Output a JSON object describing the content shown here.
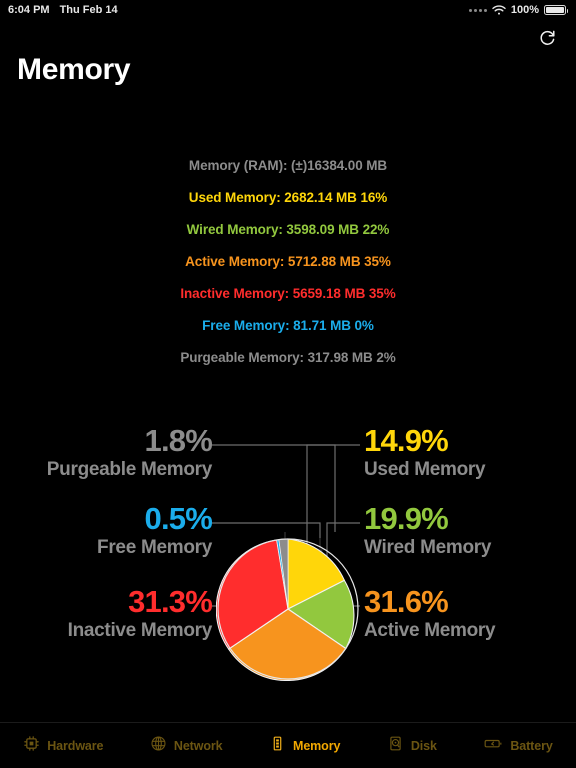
{
  "statusbar": {
    "time": "6:04 PM",
    "date": "Thu Feb 14",
    "signal_icon": "signal-dots-icon",
    "wifi_icon": "wifi-icon",
    "battery_percent": "100%",
    "battery_icon": "battery-full-icon"
  },
  "header": {
    "title": "Memory",
    "refresh_icon": "refresh-icon"
  },
  "stats": [
    {
      "text": "Memory (RAM): (±)16384.00 MB",
      "color": "#8c8c8c"
    },
    {
      "text": "Used Memory: 2682.14 MB 16%",
      "color": "#ffd60a"
    },
    {
      "text": "Wired Memory: 3598.09 MB 22%",
      "color": "#92c83e"
    },
    {
      "text": "Active Memory: 5712.88 MB 35%",
      "color": "#f7941e"
    },
    {
      "text": "Inactive Memory: 5659.18 MB 35%",
      "color": "#ff2d2d"
    },
    {
      "text": "Free Memory: 81.71 MB 0%",
      "color": "#1badeb"
    },
    {
      "text": "Purgeable Memory: 317.98 MB 2%",
      "color": "#8c8c8c"
    }
  ],
  "chart_data": {
    "type": "pie",
    "title": "Memory",
    "labels": [
      "Used Memory",
      "Wired Memory",
      "Active Memory",
      "Inactive Memory",
      "Free Memory",
      "Purgeable Memory"
    ],
    "values": [
      14.9,
      19.9,
      31.6,
      31.3,
      0.5,
      1.8
    ],
    "unit": "%",
    "colors": [
      "#ffd60a",
      "#92c83e",
      "#f7941e",
      "#ff2d2d",
      "#1badeb",
      "#8c8c8c"
    ],
    "start_angle_deg": 0,
    "direction": "clockwise",
    "legend": "callout-labels",
    "slices": [
      {
        "label": "Used Memory",
        "value": 14.9,
        "display": "14.9%",
        "color": "#ffd60a"
      },
      {
        "label": "Wired Memory",
        "value": 19.9,
        "display": "19.9%",
        "color": "#92c83e"
      },
      {
        "label": "Active Memory",
        "value": 31.6,
        "display": "31.6%",
        "color": "#f7941e"
      },
      {
        "label": "Inactive Memory",
        "value": 31.3,
        "display": "31.3%",
        "color": "#ff2d2d"
      },
      {
        "label": "Free Memory",
        "value": 0.5,
        "display": "0.5%",
        "color": "#1badeb"
      },
      {
        "label": "Purgeable Memory",
        "value": 1.8,
        "display": "1.8%",
        "color": "#8c8c8c"
      }
    ]
  },
  "callouts": {
    "purgeable": {
      "pct": "1.8%",
      "name": "Purgeable Memory",
      "color": "#8c8c8c"
    },
    "free": {
      "pct": "0.5%",
      "name": "Free Memory",
      "color": "#1badeb"
    },
    "inactive": {
      "pct": "31.3%",
      "name": "Inactive Memory",
      "color": "#ff2d2d"
    },
    "used": {
      "pct": "14.9%",
      "name": "Used Memory",
      "color": "#ffd60a"
    },
    "wired": {
      "pct": "19.9%",
      "name": "Wired Memory",
      "color": "#92c83e"
    },
    "active": {
      "pct": "31.6%",
      "name": "Active Memory",
      "color": "#f7941e"
    }
  },
  "tabbar": {
    "items": [
      {
        "label": "Hardware",
        "icon": "cpu-chip-icon",
        "active": false
      },
      {
        "label": "Network",
        "icon": "globe-icon",
        "active": false
      },
      {
        "label": "Memory",
        "icon": "ram-stick-icon",
        "active": true
      },
      {
        "label": "Disk",
        "icon": "hard-drive-icon",
        "active": false
      },
      {
        "label": "Battery",
        "icon": "battery-icon",
        "active": false
      }
    ]
  }
}
